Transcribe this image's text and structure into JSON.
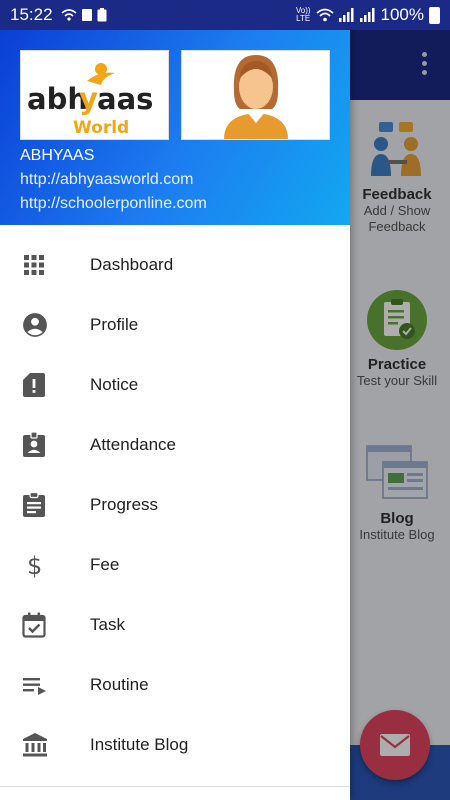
{
  "status_bar": {
    "time": "15:22",
    "volte_line1": "Vo))",
    "volte_line2": "LTE",
    "battery": "100%"
  },
  "drawer": {
    "header": {
      "logo_text_main": "abhyaas",
      "logo_text_sub": "World",
      "name": "ABHYAAS",
      "url1": "http://abhyaasworld.com",
      "url2": "http://schoolerponline.com"
    },
    "items": [
      {
        "label": "Dashboard",
        "icon": "grid-icon"
      },
      {
        "label": "Profile",
        "icon": "account-circle-icon"
      },
      {
        "label": "Notice",
        "icon": "notice-icon"
      },
      {
        "label": "Attendance",
        "icon": "badge-icon"
      },
      {
        "label": "Progress",
        "icon": "clipboard-icon"
      },
      {
        "label": "Fee",
        "icon": "dollar-icon"
      },
      {
        "label": "Task",
        "icon": "calendar-check-icon"
      },
      {
        "label": "Routine",
        "icon": "playlist-icon"
      },
      {
        "label": "Institute Blog",
        "icon": "bank-icon"
      }
    ]
  },
  "background": {
    "tiles": [
      {
        "title": "Feedback",
        "subtitle": "Add / Show Feedback"
      },
      {
        "title": "Practice",
        "subtitle": "Test your Skill"
      },
      {
        "title": "Blog",
        "subtitle": "Institute Blog"
      }
    ]
  },
  "colors": {
    "status_bar": "#1b2a86",
    "header_gradient_start": "#0a3fd6",
    "header_gradient_end": "#12a8f0",
    "fab": "#e0455d",
    "menu_icon": "#555555"
  }
}
